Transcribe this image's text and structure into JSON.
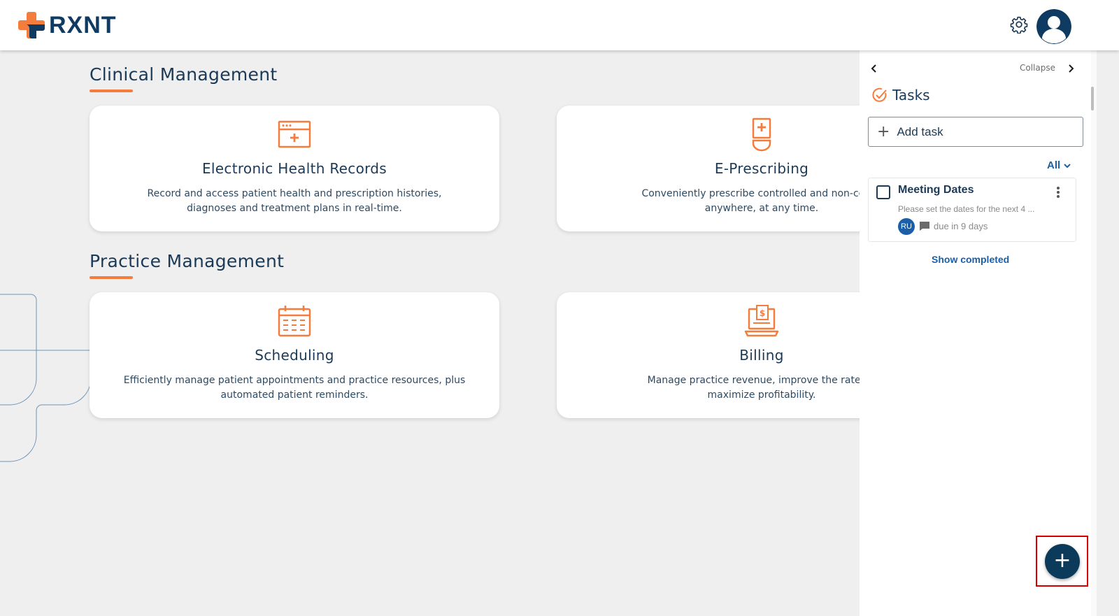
{
  "header": {
    "logo_text": "RXNT",
    "icons": {
      "settings": "gear-icon",
      "profile": "user-avatar-icon"
    }
  },
  "sections": [
    {
      "title": "Clinical Management",
      "cards": [
        {
          "title": "Electronic Health Records",
          "desc_line1": "Record and access patient health and prescription histories,",
          "desc_line2": "diagnoses and treatment plans in real-time.",
          "icon": "ehr-record-icon"
        },
        {
          "title": "E-Prescribing",
          "desc_line1": "Conveniently prescribe controlled and non-controlled su",
          "desc_line2": "anywhere, at any time.",
          "icon": "prescription-bottle-icon"
        }
      ]
    },
    {
      "title": "Practice Management",
      "cards": [
        {
          "title": "Scheduling",
          "desc_line1": "Efficiently manage patient appointments and practice resources, plus",
          "desc_line2": "automated patient reminders.",
          "icon": "calendar-icon"
        },
        {
          "title": "Billing",
          "desc_line1": "Manage practice revenue, improve the rate of reimbu",
          "desc_line2": "maximize profitability.",
          "icon": "billing-laptop-icon"
        }
      ]
    }
  ],
  "tasks_panel": {
    "collapse_label": "Collapse",
    "title": "Tasks",
    "add_task_label": "Add task",
    "filter_label": "All",
    "tasks": [
      {
        "title": "Meeting Dates",
        "description": "Please set the dates for the next 4 ...",
        "assignee_initials": "RU",
        "due": "due in 9 days"
      }
    ],
    "show_completed_label": "Show completed"
  },
  "fab": {
    "label": "+",
    "icon": "plus-icon"
  },
  "colors": {
    "brand_navy": "#0f3b63",
    "accent_orange": "#f47c3c",
    "link_blue": "#1a5fa8",
    "fab_bg": "#0c3a5a",
    "highlight_red": "#d40000"
  }
}
